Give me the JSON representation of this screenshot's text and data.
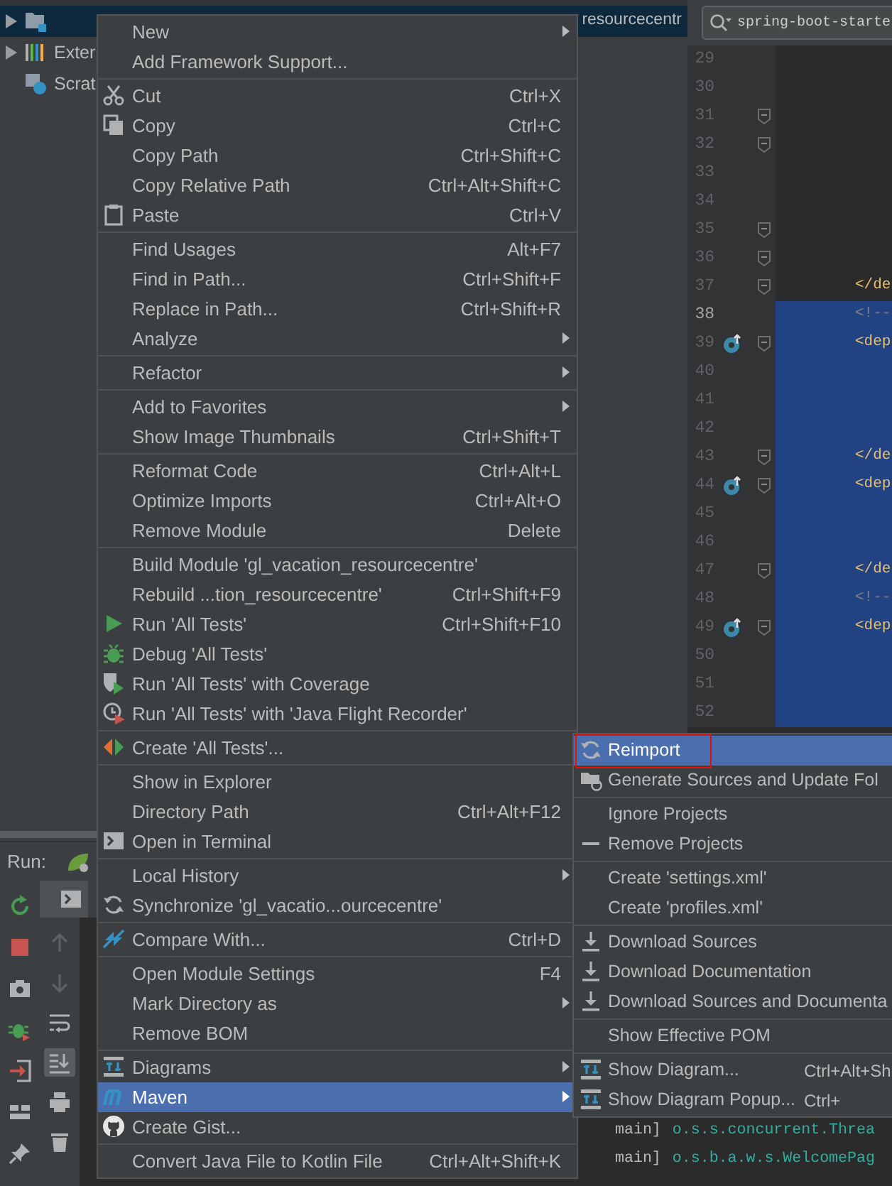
{
  "project_tree": {
    "rows": [
      {
        "label": "resourcecentr",
        "selected": true,
        "expandable": true
      },
      {
        "label": "Exter",
        "selected": false,
        "expandable": true
      },
      {
        "label": "Scrat",
        "selected": false,
        "expandable": false
      }
    ]
  },
  "editor": {
    "search": {
      "value": "spring-boot-starte"
    },
    "lines": [
      {
        "number": "29",
        "selected": false,
        "current": false,
        "fold": false,
        "marker": false
      },
      {
        "number": "30",
        "selected": false,
        "current": false,
        "fold": false,
        "marker": false
      },
      {
        "number": "31",
        "selected": false,
        "current": false,
        "fold": true,
        "marker": false
      },
      {
        "number": "32",
        "selected": false,
        "current": false,
        "fold": true,
        "marker": false
      },
      {
        "number": "33",
        "selected": false,
        "current": false,
        "fold": false,
        "marker": false
      },
      {
        "number": "34",
        "selected": false,
        "current": false,
        "fold": false,
        "marker": false
      },
      {
        "number": "35",
        "selected": false,
        "current": false,
        "fold": true,
        "marker": false
      },
      {
        "number": "36",
        "selected": false,
        "current": false,
        "fold": true,
        "marker": false
      },
      {
        "number": "37",
        "selected": false,
        "current": false,
        "fold": true,
        "marker": false,
        "code": {
          "text": "</de",
          "kind": "tag"
        }
      },
      {
        "number": "38",
        "selected": true,
        "current": true,
        "fold": false,
        "marker": false,
        "code": {
          "text": "<!--",
          "kind": "comment"
        }
      },
      {
        "number": "39",
        "selected": true,
        "current": false,
        "fold": true,
        "marker": true,
        "code": {
          "text": "<dep",
          "kind": "tag"
        }
      },
      {
        "number": "40",
        "selected": true,
        "current": false,
        "fold": false,
        "marker": false
      },
      {
        "number": "41",
        "selected": true,
        "current": false,
        "fold": false,
        "marker": false
      },
      {
        "number": "42",
        "selected": true,
        "current": false,
        "fold": false,
        "marker": false
      },
      {
        "number": "43",
        "selected": true,
        "current": false,
        "fold": true,
        "marker": false,
        "code": {
          "text": "</de",
          "kind": "tag"
        }
      },
      {
        "number": "44",
        "selected": true,
        "current": false,
        "fold": true,
        "marker": true,
        "code": {
          "text": "<dep",
          "kind": "tag"
        }
      },
      {
        "number": "45",
        "selected": true,
        "current": false,
        "fold": false,
        "marker": false
      },
      {
        "number": "46",
        "selected": true,
        "current": false,
        "fold": false,
        "marker": false
      },
      {
        "number": "47",
        "selected": true,
        "current": false,
        "fold": true,
        "marker": false,
        "code": {
          "text": "</de",
          "kind": "tag"
        }
      },
      {
        "number": "48",
        "selected": true,
        "current": false,
        "fold": false,
        "marker": false,
        "code": {
          "text": "<!--",
          "kind": "comment"
        }
      },
      {
        "number": "49",
        "selected": true,
        "current": false,
        "fold": true,
        "marker": true,
        "code": {
          "text": "<dep",
          "kind": "tag"
        }
      },
      {
        "number": "50",
        "selected": true,
        "current": false,
        "fold": false,
        "marker": false
      },
      {
        "number": "51",
        "selected": true,
        "current": false,
        "fold": false,
        "marker": false
      },
      {
        "number": "52",
        "selected": true,
        "current": false,
        "fold": false,
        "marker": false
      }
    ]
  },
  "run_panel": {
    "title": "Run:",
    "console": [
      {
        "thread": "main]",
        "logger": "o.s.s.concurrent.Threa"
      },
      {
        "thread": "main]",
        "logger": "o.s.b.a.w.s.WelcomePag"
      }
    ]
  },
  "context_menu": {
    "groups": [
      [
        {
          "label": "New",
          "submenu": true,
          "selected": false
        },
        {
          "label": "Add Framework Support...",
          "submenu": false,
          "selected": false
        }
      ],
      [
        {
          "label": "Cut",
          "shortcut": "Ctrl+X",
          "submenu": false,
          "selected": false
        },
        {
          "label": "Copy",
          "shortcut": "Ctrl+C",
          "submenu": false,
          "selected": false
        },
        {
          "label": "Copy Path",
          "shortcut": "Ctrl+Shift+C",
          "submenu": false,
          "selected": false
        },
        {
          "label": "Copy Relative Path",
          "shortcut": "Ctrl+Alt+Shift+C",
          "submenu": false,
          "selected": false
        },
        {
          "label": "Paste",
          "shortcut": "Ctrl+V",
          "submenu": false,
          "selected": false
        }
      ],
      [
        {
          "label": "Find Usages",
          "shortcut": "Alt+F7",
          "submenu": false,
          "selected": false
        },
        {
          "label": "Find in Path...",
          "shortcut": "Ctrl+Shift+F",
          "submenu": false,
          "selected": false
        },
        {
          "label": "Replace in Path...",
          "shortcut": "Ctrl+Shift+R",
          "submenu": false,
          "selected": false
        },
        {
          "label": "Analyze",
          "submenu": true,
          "selected": false
        }
      ],
      [
        {
          "label": "Refactor",
          "submenu": true,
          "selected": false
        }
      ],
      [
        {
          "label": "Add to Favorites",
          "submenu": true,
          "selected": false
        },
        {
          "label": "Show Image Thumbnails",
          "shortcut": "Ctrl+Shift+T",
          "submenu": false,
          "selected": false
        }
      ],
      [
        {
          "label": "Reformat Code",
          "shortcut": "Ctrl+Alt+L",
          "submenu": false,
          "selected": false
        },
        {
          "label": "Optimize Imports",
          "shortcut": "Ctrl+Alt+O",
          "submenu": false,
          "selected": false
        },
        {
          "label": "Remove Module",
          "shortcut": "Delete",
          "submenu": false,
          "selected": false
        }
      ],
      [
        {
          "label": "Build Module 'gl_vacation_resourcecentre'",
          "submenu": false,
          "selected": false
        },
        {
          "label": "Rebuild ...tion_resourcecentre'",
          "shortcut": "Ctrl+Shift+F9",
          "submenu": false,
          "selected": false
        },
        {
          "label": "Run 'All Tests'",
          "shortcut": "Ctrl+Shift+F10",
          "submenu": false,
          "selected": false
        },
        {
          "label": "Debug 'All Tests'",
          "submenu": false,
          "selected": false
        },
        {
          "label": "Run 'All Tests' with Coverage",
          "submenu": false,
          "selected": false
        },
        {
          "label": "Run 'All Tests' with 'Java Flight Recorder'",
          "submenu": false,
          "selected": false
        }
      ],
      [
        {
          "label": "Create 'All Tests'...",
          "submenu": false,
          "selected": false
        }
      ],
      [
        {
          "label": "Show in Explorer",
          "submenu": false,
          "selected": false
        },
        {
          "label": "Directory Path",
          "shortcut": "Ctrl+Alt+F12",
          "submenu": false,
          "selected": false
        },
        {
          "label": "Open in Terminal",
          "submenu": false,
          "selected": false
        }
      ],
      [
        {
          "label": "Local History",
          "submenu": true,
          "selected": false
        },
        {
          "label": "Synchronize 'gl_vacatio...ourcecentre'",
          "submenu": false,
          "selected": false
        }
      ],
      [
        {
          "label": "Compare With...",
          "shortcut": "Ctrl+D",
          "submenu": false,
          "selected": false
        }
      ],
      [
        {
          "label": "Open Module Settings",
          "shortcut": "F4",
          "submenu": false,
          "selected": false
        },
        {
          "label": "Mark Directory as",
          "submenu": true,
          "selected": false
        },
        {
          "label": "Remove BOM",
          "submenu": false,
          "selected": false
        }
      ],
      [
        {
          "label": "Diagrams",
          "submenu": true,
          "selected": false
        },
        {
          "label": "Maven",
          "submenu": true,
          "selected": true
        },
        {
          "label": "Create Gist...",
          "submenu": false,
          "selected": false
        }
      ],
      [
        {
          "label": "Convert Java File to Kotlin File",
          "shortcut": "Ctrl+Alt+Shift+K",
          "submenu": false,
          "selected": false
        }
      ]
    ]
  },
  "maven_submenu": {
    "groups": [
      [
        {
          "label": "Reimport",
          "selected": true,
          "outlined": true
        },
        {
          "label": "Generate Sources and Update Fol",
          "selected": false,
          "outlined": false
        }
      ],
      [
        {
          "label": "Ignore Projects",
          "selected": false,
          "outlined": false
        },
        {
          "label": "Remove Projects",
          "selected": false,
          "outlined": false
        }
      ],
      [
        {
          "label": "Create 'settings.xml'",
          "selected": false,
          "outlined": false
        },
        {
          "label": "Create 'profiles.xml'",
          "selected": false,
          "outlined": false
        }
      ],
      [
        {
          "label": "Download Sources",
          "selected": false,
          "outlined": false
        },
        {
          "label": "Download Documentation",
          "selected": false,
          "outlined": false
        },
        {
          "label": "Download Sources and Documenta",
          "selected": false,
          "outlined": false
        }
      ],
      [
        {
          "label": "Show Effective POM",
          "selected": false,
          "outlined": false
        }
      ],
      [
        {
          "label": "Show Diagram...",
          "shortcut": "Ctrl+Alt+Sh",
          "selected": false,
          "outlined": false
        },
        {
          "label": "Show Diagram Popup...",
          "shortcut": "Ctrl+",
          "selected": false,
          "outlined": false
        }
      ]
    ]
  }
}
